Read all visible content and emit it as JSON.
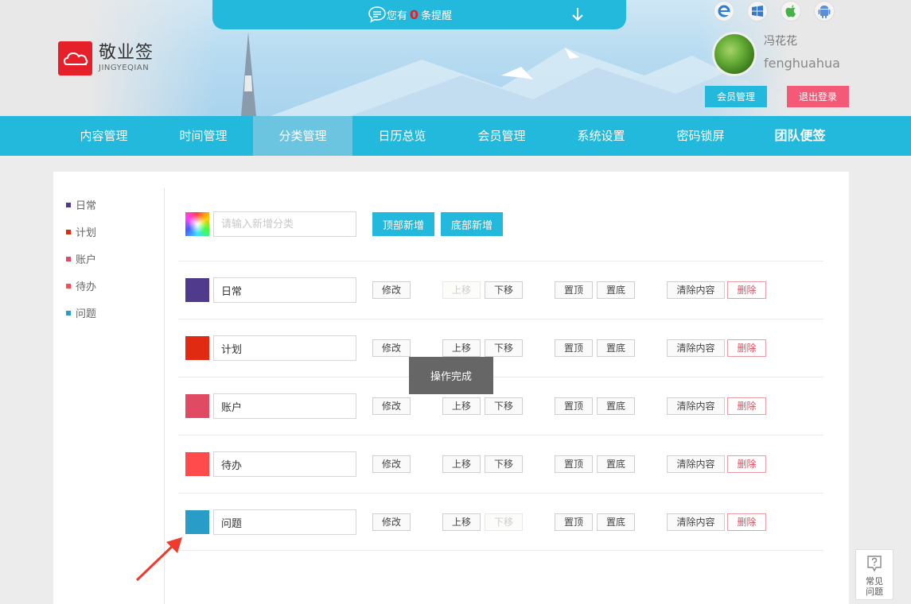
{
  "app": {
    "logo_cn": "敬业签",
    "logo_en": "JINGYEQIAN",
    "brand_color": "#e5202b",
    "accent_color": "#22b9dd"
  },
  "notice": {
    "prefix": "您有",
    "count": "0",
    "suffix": "条提醒",
    "icon": "chat-bubble-icon",
    "expand_icon": "arrow-down-icon"
  },
  "platforms": [
    "ie-icon",
    "windows-icon",
    "apple-icon",
    "android-icon"
  ],
  "user": {
    "name_cn": "冯花花",
    "name_en": "fenghuahua",
    "member_button": "会员管理",
    "logout_button": "退出登录"
  },
  "nav": {
    "items": [
      {
        "label": "内容管理",
        "active": false
      },
      {
        "label": "时间管理",
        "active": false
      },
      {
        "label": "分类管理",
        "active": true
      },
      {
        "label": "日历总览",
        "active": false
      },
      {
        "label": "会员管理",
        "active": false
      },
      {
        "label": "系统设置",
        "active": false
      },
      {
        "label": "密码锁屏",
        "active": false
      },
      {
        "label": "团队便签",
        "active": false
      }
    ]
  },
  "sidebar": {
    "items": [
      {
        "label": "日常",
        "color": "#4f3a8c"
      },
      {
        "label": "计划",
        "color": "#e12a12"
      },
      {
        "label": "账户",
        "color": "#e04a63"
      },
      {
        "label": "待办",
        "color": "#ff4b4b"
      },
      {
        "label": "问题",
        "color": "#2a9cc8"
      }
    ]
  },
  "add_category": {
    "placeholder": "请输入新增分类",
    "top_add": "顶部新增",
    "bottom_add": "底部新增"
  },
  "actions": {
    "edit": "修改",
    "move_up": "上移",
    "move_down": "下移",
    "to_top": "置顶",
    "to_bottom": "置底",
    "clear": "清除内容",
    "delete": "删除"
  },
  "categories": [
    {
      "name": "日常",
      "color": "#4f3a8c",
      "up_disabled": true,
      "down_disabled": false
    },
    {
      "name": "计划",
      "color": "#e12a12",
      "up_disabled": false,
      "down_disabled": false
    },
    {
      "name": "账户",
      "color": "#e04a63",
      "up_disabled": false,
      "down_disabled": false
    },
    {
      "name": "待办",
      "color": "#ff4b4b",
      "up_disabled": false,
      "down_disabled": false
    },
    {
      "name": "问题",
      "color": "#2a9cc8",
      "up_disabled": false,
      "down_disabled": true
    }
  ],
  "toast": "操作完成",
  "faq": {
    "line1": "常见",
    "line2": "问题"
  }
}
